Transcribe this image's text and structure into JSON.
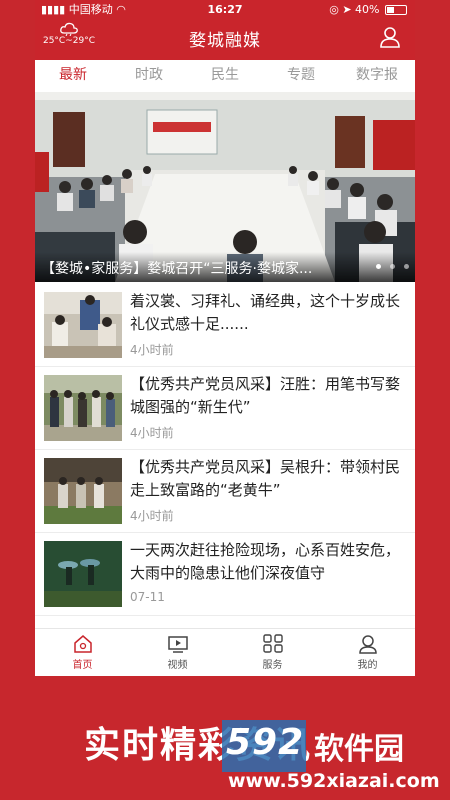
{
  "status_bar": {
    "carrier": "中国移动",
    "time": "16:27",
    "battery": "40%"
  },
  "header": {
    "weather": "25°C~29°C",
    "title": "婺城融媒"
  },
  "tabs": [
    {
      "label": "最新",
      "active": true
    },
    {
      "label": "时政",
      "active": false
    },
    {
      "label": "民生",
      "active": false
    },
    {
      "label": "专题",
      "active": false
    },
    {
      "label": "数字报",
      "active": false
    }
  ],
  "banner": {
    "caption": "【婺城•家服务】婺城召开“三服务·婺城家...",
    "slide_count": 3,
    "active_slide": 1
  },
  "news": [
    {
      "title": "着汉裳、习拜礼、诵经典，这个十岁成长礼仪式感十足......",
      "time": "4小时前"
    },
    {
      "title": "【优秀共产党员风采】汪胜：用笔书写婺城图强的“新生代”",
      "time": "4小时前"
    },
    {
      "title": "【优秀共产党员风采】吴根升：带领村民走上致富路的“老黄牛”",
      "time": "4小时前"
    },
    {
      "title": "一天两次赶往抢险现场，心系百姓安危，大雨中的隐患让他们深夜值守",
      "time": "07-11"
    }
  ],
  "bottom_nav": [
    {
      "label": "首页",
      "icon": "home-icon",
      "active": true
    },
    {
      "label": "视频",
      "icon": "video-icon",
      "active": false
    },
    {
      "label": "服务",
      "icon": "grid-icon",
      "active": false
    },
    {
      "label": "我的",
      "icon": "profile-icon",
      "active": false
    }
  ],
  "promo": {
    "slogan": "实时精彩资讯"
  },
  "watermark": {
    "brand_number": "592",
    "brand_name": "软件园",
    "url": "www.592xiazai.com"
  },
  "colors": {
    "brand_red": "#c9252c",
    "tab_inactive": "#999999"
  }
}
